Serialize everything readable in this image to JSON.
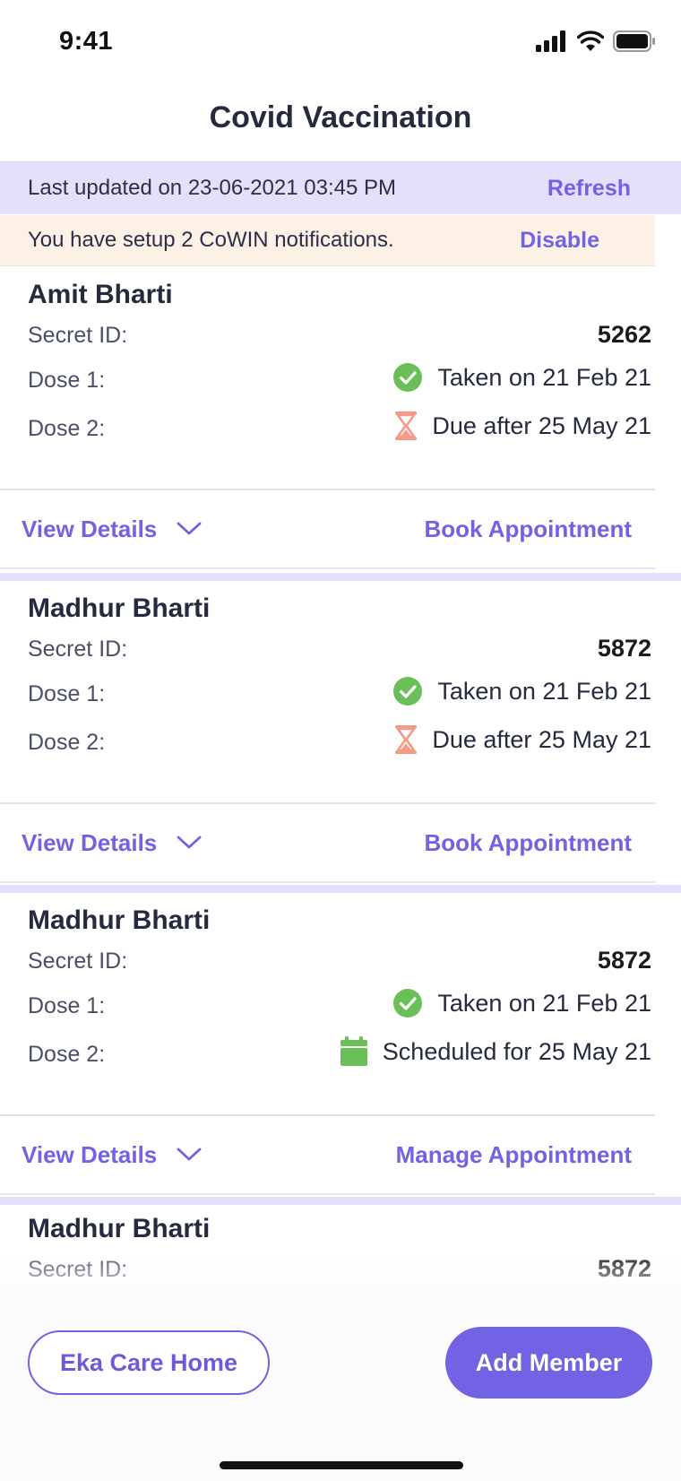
{
  "status_bar": {
    "time": "9:41"
  },
  "header": {
    "title": "Covid Vaccination"
  },
  "update_banner": {
    "text": "Last updated on 23-06-2021 03:45 PM",
    "action": "Refresh"
  },
  "notify_banner": {
    "text": "You have setup 2 CoWIN notifications.",
    "action": "Disable"
  },
  "labels": {
    "secret_id": "Secret ID:",
    "dose1": "Dose 1:",
    "dose2": "Dose 2:",
    "view_details": "View Details"
  },
  "members": [
    {
      "name": "Amit Bharti",
      "secret_id": "5262",
      "dose1": {
        "status_icon": "check-circle-icon",
        "text": "Taken on 21 Feb 21"
      },
      "dose2": {
        "status_icon": "hourglass-icon",
        "text": "Due after 25 May 21"
      },
      "action": "Book Appointment"
    },
    {
      "name": "Madhur Bharti",
      "secret_id": "5872",
      "dose1": {
        "status_icon": "check-circle-icon",
        "text": "Taken on 21 Feb 21"
      },
      "dose2": {
        "status_icon": "hourglass-icon",
        "text": "Due after 25 May 21"
      },
      "action": "Book Appointment"
    },
    {
      "name": "Madhur Bharti",
      "secret_id": "5872",
      "dose1": {
        "status_icon": "check-circle-icon",
        "text": "Taken on 21 Feb 21"
      },
      "dose2": {
        "status_icon": "calendar-icon",
        "text": "Scheduled for 25 May 21"
      },
      "action": "Manage Appointment"
    },
    {
      "name": "Madhur Bharti",
      "secret_id": "5872"
    }
  ],
  "bottom": {
    "home_button": "Eka Care Home",
    "add_button": "Add Member"
  },
  "colors": {
    "accent": "#7262e4",
    "success": "#6bbf59",
    "warning": "#f59a86",
    "banner_purple": "#e4e0fb",
    "banner_orange": "#fdf0e4"
  }
}
